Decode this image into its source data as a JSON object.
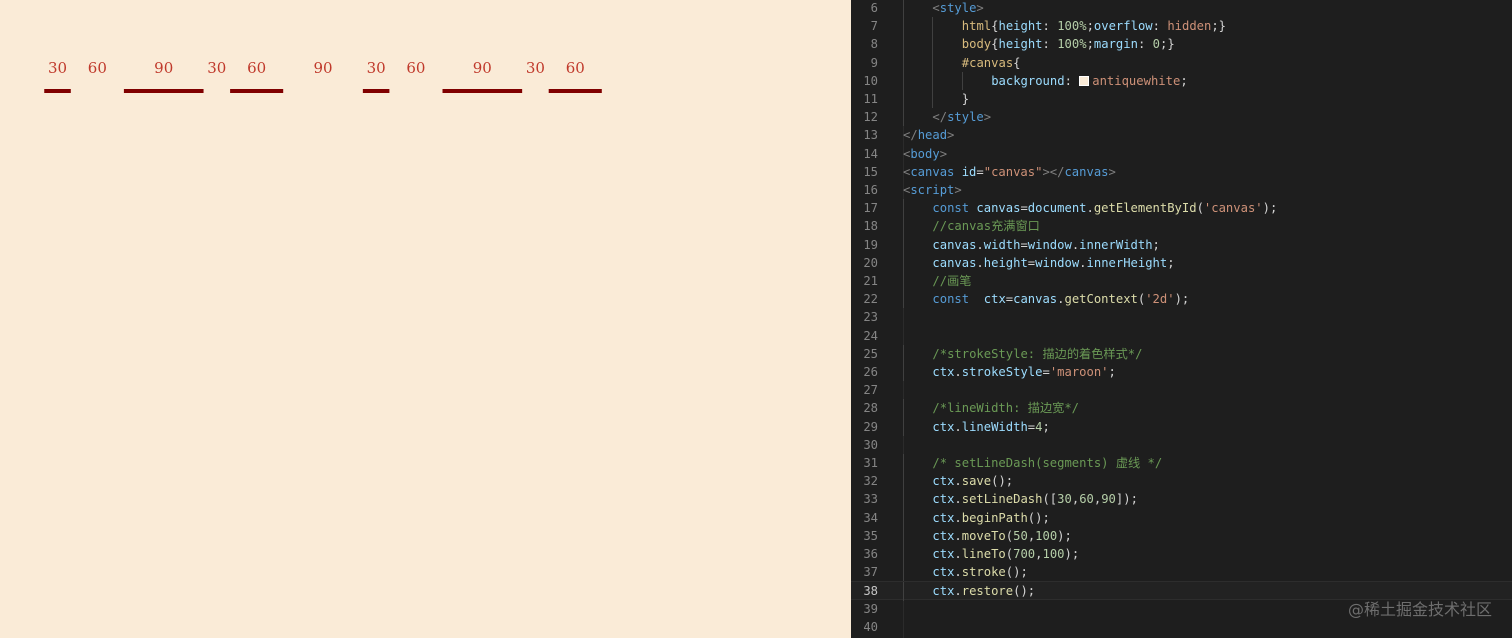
{
  "preview": {
    "background": "#faebd7",
    "stroke_color": "#800000",
    "dash_pattern": [
      30,
      60,
      90
    ],
    "line_start": [
      50,
      100
    ],
    "line_end": [
      700,
      100
    ],
    "labels": [
      "30",
      "60",
      "90",
      "30",
      "60",
      "90",
      "30",
      "60",
      "90",
      "30",
      "60"
    ]
  },
  "editor": {
    "current_line": 38,
    "swatch_color": "#faebd7",
    "watermark": "@稀土掘金技术社区",
    "lines": [
      {
        "n": "6",
        "indent": 1,
        "tokens": [
          [
            "br",
            "<"
          ],
          [
            "tag",
            "style"
          ],
          [
            "br",
            ">"
          ]
        ]
      },
      {
        "n": "7",
        "indent": 2,
        "tokens": [
          [
            "sel",
            "html"
          ],
          [
            "plain",
            "{"
          ],
          [
            "prop",
            "height"
          ],
          [
            "plain",
            ": "
          ],
          [
            "num",
            "100%"
          ],
          [
            "plain",
            ";"
          ],
          [
            "prop",
            "overflow"
          ],
          [
            "plain",
            ": "
          ],
          [
            "val",
            "hidden"
          ],
          [
            "plain",
            ";}"
          ]
        ]
      },
      {
        "n": "8",
        "indent": 2,
        "tokens": [
          [
            "sel",
            "body"
          ],
          [
            "plain",
            "{"
          ],
          [
            "prop",
            "height"
          ],
          [
            "plain",
            ": "
          ],
          [
            "num",
            "100%"
          ],
          [
            "plain",
            ";"
          ],
          [
            "prop",
            "margin"
          ],
          [
            "plain",
            ": "
          ],
          [
            "num",
            "0"
          ],
          [
            "plain",
            ";}"
          ]
        ]
      },
      {
        "n": "9",
        "indent": 2,
        "tokens": [
          [
            "sel",
            "#canvas"
          ],
          [
            "plain",
            "{"
          ]
        ]
      },
      {
        "n": "10",
        "indent": 3,
        "tokens": [
          [
            "prop",
            "background"
          ],
          [
            "plain",
            ": "
          ],
          [
            "swatch",
            ""
          ],
          [
            "val",
            "antiquewhite"
          ],
          [
            "plain",
            ";"
          ]
        ]
      },
      {
        "n": "11",
        "indent": 2,
        "tokens": [
          [
            "plain",
            "}"
          ]
        ]
      },
      {
        "n": "12",
        "indent": 1,
        "tokens": [
          [
            "br",
            "</"
          ],
          [
            "tag",
            "style"
          ],
          [
            "br",
            ">"
          ]
        ]
      },
      {
        "n": "13",
        "indent": 0,
        "tokens": [
          [
            "br",
            "</"
          ],
          [
            "tag",
            "head"
          ],
          [
            "br",
            ">"
          ]
        ]
      },
      {
        "n": "14",
        "indent": 0,
        "tokens": [
          [
            "br",
            "<"
          ],
          [
            "tag",
            "body"
          ],
          [
            "br",
            ">"
          ]
        ]
      },
      {
        "n": "15",
        "indent": 0,
        "tokens": [
          [
            "br",
            "<"
          ],
          [
            "tag",
            "canvas"
          ],
          [
            "plain",
            " "
          ],
          [
            "attr",
            "id"
          ],
          [
            "plain",
            "="
          ],
          [
            "str",
            "\"canvas\""
          ],
          [
            "br",
            "></"
          ],
          [
            "tag",
            "canvas"
          ],
          [
            "br",
            ">"
          ]
        ]
      },
      {
        "n": "16",
        "indent": 0,
        "tokens": [
          [
            "br",
            "<"
          ],
          [
            "tag",
            "script"
          ],
          [
            "br",
            ">"
          ]
        ]
      },
      {
        "n": "17",
        "indent": 1,
        "tokens": [
          [
            "kw",
            "const"
          ],
          [
            "plain",
            " "
          ],
          [
            "var",
            "canvas"
          ],
          [
            "plain",
            "="
          ],
          [
            "var",
            "document"
          ],
          [
            "plain",
            "."
          ],
          [
            "fn",
            "getElementById"
          ],
          [
            "plain",
            "("
          ],
          [
            "str",
            "'canvas'"
          ],
          [
            "plain",
            ");"
          ]
        ]
      },
      {
        "n": "18",
        "indent": 1,
        "tokens": [
          [
            "com",
            "//canvas充满窗口"
          ]
        ]
      },
      {
        "n": "19",
        "indent": 1,
        "tokens": [
          [
            "var",
            "canvas"
          ],
          [
            "plain",
            "."
          ],
          [
            "var",
            "width"
          ],
          [
            "plain",
            "="
          ],
          [
            "var",
            "window"
          ],
          [
            "plain",
            "."
          ],
          [
            "var",
            "innerWidth"
          ],
          [
            "plain",
            ";"
          ]
        ]
      },
      {
        "n": "20",
        "indent": 1,
        "tokens": [
          [
            "var",
            "canvas"
          ],
          [
            "plain",
            "."
          ],
          [
            "var",
            "height"
          ],
          [
            "plain",
            "="
          ],
          [
            "var",
            "window"
          ],
          [
            "plain",
            "."
          ],
          [
            "var",
            "innerHeight"
          ],
          [
            "plain",
            ";"
          ]
        ]
      },
      {
        "n": "21",
        "indent": 1,
        "tokens": [
          [
            "com",
            "//画笔"
          ]
        ]
      },
      {
        "n": "22",
        "indent": 1,
        "tokens": [
          [
            "kw",
            "const"
          ],
          [
            "plain",
            "  "
          ],
          [
            "var",
            "ctx"
          ],
          [
            "plain",
            "="
          ],
          [
            "var",
            "canvas"
          ],
          [
            "plain",
            "."
          ],
          [
            "fn",
            "getContext"
          ],
          [
            "plain",
            "("
          ],
          [
            "str",
            "'2d'"
          ],
          [
            "plain",
            ");"
          ]
        ]
      },
      {
        "n": "23",
        "indent": 0,
        "tokens": []
      },
      {
        "n": "24",
        "indent": 0,
        "tokens": []
      },
      {
        "n": "25",
        "indent": 1,
        "tokens": [
          [
            "com",
            "/*strokeStyle: 描边的着色样式*/"
          ]
        ]
      },
      {
        "n": "26",
        "indent": 1,
        "tokens": [
          [
            "var",
            "ctx"
          ],
          [
            "plain",
            "."
          ],
          [
            "var",
            "strokeStyle"
          ],
          [
            "plain",
            "="
          ],
          [
            "str",
            "'maroon'"
          ],
          [
            "plain",
            ";"
          ]
        ]
      },
      {
        "n": "27",
        "indent": 0,
        "tokens": []
      },
      {
        "n": "28",
        "indent": 1,
        "tokens": [
          [
            "com",
            "/*lineWidth: 描边宽*/"
          ]
        ]
      },
      {
        "n": "29",
        "indent": 1,
        "tokens": [
          [
            "var",
            "ctx"
          ],
          [
            "plain",
            "."
          ],
          [
            "var",
            "lineWidth"
          ],
          [
            "plain",
            "="
          ],
          [
            "num",
            "4"
          ],
          [
            "plain",
            ";"
          ]
        ]
      },
      {
        "n": "30",
        "indent": 0,
        "tokens": []
      },
      {
        "n": "31",
        "indent": 1,
        "tokens": [
          [
            "com",
            "/* setLineDash(segments) 虚线 */"
          ]
        ]
      },
      {
        "n": "32",
        "indent": 1,
        "tokens": [
          [
            "var",
            "ctx"
          ],
          [
            "plain",
            "."
          ],
          [
            "fn",
            "save"
          ],
          [
            "plain",
            "();"
          ]
        ]
      },
      {
        "n": "33",
        "indent": 1,
        "tokens": [
          [
            "var",
            "ctx"
          ],
          [
            "plain",
            "."
          ],
          [
            "fn",
            "setLineDash"
          ],
          [
            "plain",
            "(["
          ],
          [
            "num",
            "30"
          ],
          [
            "plain",
            ","
          ],
          [
            "num",
            "60"
          ],
          [
            "plain",
            ","
          ],
          [
            "num",
            "90"
          ],
          [
            "plain",
            "]);"
          ]
        ]
      },
      {
        "n": "34",
        "indent": 1,
        "tokens": [
          [
            "var",
            "ctx"
          ],
          [
            "plain",
            "."
          ],
          [
            "fn",
            "beginPath"
          ],
          [
            "plain",
            "();"
          ]
        ]
      },
      {
        "n": "35",
        "indent": 1,
        "tokens": [
          [
            "var",
            "ctx"
          ],
          [
            "plain",
            "."
          ],
          [
            "fn",
            "moveTo"
          ],
          [
            "plain",
            "("
          ],
          [
            "num",
            "50"
          ],
          [
            "plain",
            ","
          ],
          [
            "num",
            "100"
          ],
          [
            "plain",
            ");"
          ]
        ]
      },
      {
        "n": "36",
        "indent": 1,
        "tokens": [
          [
            "var",
            "ctx"
          ],
          [
            "plain",
            "."
          ],
          [
            "fn",
            "lineTo"
          ],
          [
            "plain",
            "("
          ],
          [
            "num",
            "700"
          ],
          [
            "plain",
            ","
          ],
          [
            "num",
            "100"
          ],
          [
            "plain",
            ");"
          ]
        ]
      },
      {
        "n": "37",
        "indent": 1,
        "tokens": [
          [
            "var",
            "ctx"
          ],
          [
            "plain",
            "."
          ],
          [
            "fn",
            "stroke"
          ],
          [
            "plain",
            "();"
          ]
        ]
      },
      {
        "n": "38",
        "indent": 1,
        "tokens": [
          [
            "var",
            "ctx"
          ],
          [
            "plain",
            "."
          ],
          [
            "fn",
            "restore"
          ],
          [
            "plain",
            "();"
          ]
        ]
      },
      {
        "n": "39",
        "indent": 0,
        "tokens": []
      },
      {
        "n": "40",
        "indent": 0,
        "tokens": []
      }
    ]
  }
}
